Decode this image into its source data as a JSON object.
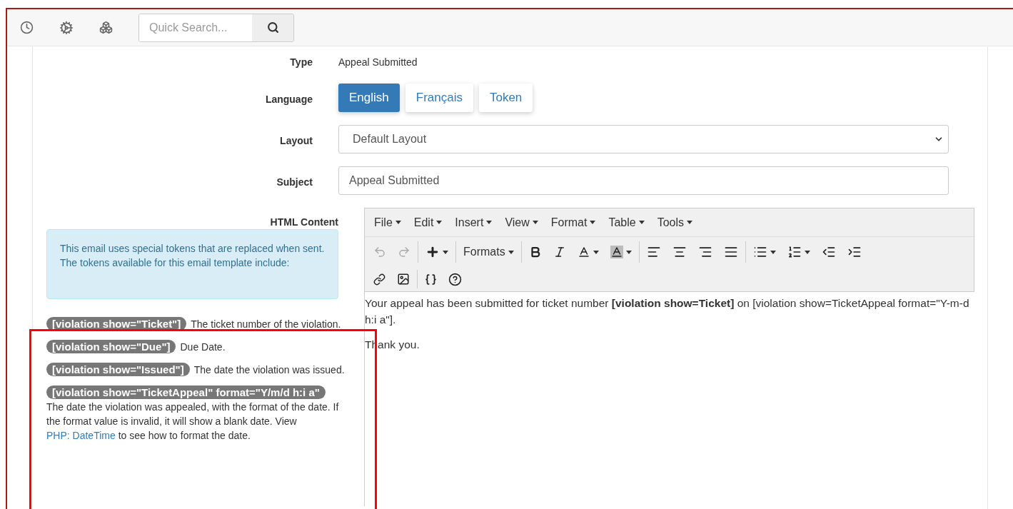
{
  "toolbar": {
    "search_placeholder": "Quick Search..."
  },
  "form": {
    "type": {
      "label": "Type",
      "value": "Appeal Submitted"
    },
    "language": {
      "label": "Language",
      "options": [
        {
          "label": "English",
          "selected": true
        },
        {
          "label": "Français",
          "selected": false
        },
        {
          "label": "Token",
          "selected": false
        }
      ]
    },
    "layout": {
      "label": "Layout",
      "value": "Default Layout"
    },
    "subject": {
      "label": "Subject",
      "value": "Appeal Submitted"
    },
    "html_content": {
      "label": "HTML Content"
    }
  },
  "info_box": "This email uses special tokens that are replaced when sent. The tokens available for this email template include:",
  "tokens": [
    {
      "token": "[violation show=\"Ticket\"]",
      "description": "The ticket number of the violation."
    },
    {
      "token": "[violation show=\"Due\"]",
      "description": "Due Date."
    },
    {
      "token": "[violation show=\"Issued\"]",
      "description": "The date the violation was issued."
    },
    {
      "token": "[violation show=\"TicketAppeal\" format=\"Y/m/d h:i a\"",
      "description": "The date the violation was appealed, with the format of the date. If the format value is invalid, it will show a blank date. View",
      "link": "PHP: DateTime",
      "description_end": "to see how to format the date."
    }
  ],
  "editor": {
    "menus": [
      "File",
      "Edit",
      "Insert",
      "View",
      "Format",
      "Table",
      "Tools"
    ],
    "formats_label": "Formats",
    "paragraphs": [
      "Your appeal has been submitted for ticket number **[violation show=Ticket]** on [violation show=TicketAppeal format=\"Y-m-d h:i a\"].",
      "Thank you."
    ]
  }
}
